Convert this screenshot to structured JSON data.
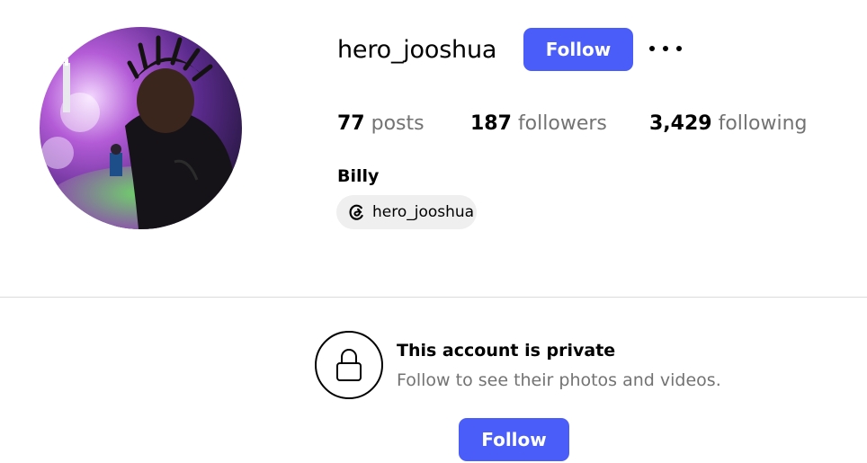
{
  "profile": {
    "username": "hero_jooshua",
    "follow_label": "Follow",
    "full_name": "Billy",
    "threads_handle": "hero_jooshua",
    "stats": [
      {
        "count": "77",
        "label": "posts"
      },
      {
        "count": "187",
        "label": "followers"
      },
      {
        "count": "3,429",
        "label": "following"
      }
    ]
  },
  "private_notice": {
    "title": "This account is private",
    "subtitle": "Follow to see their photos and videos.",
    "follow_label": "Follow"
  },
  "icons": {
    "more": "more-options-icon",
    "threads": "threads-icon",
    "lock": "lock-icon"
  },
  "colors": {
    "accent": "#4a5df9",
    "secondary_text": "#737373",
    "chip_background": "#efefef",
    "divider": "#dbdbdb"
  }
}
